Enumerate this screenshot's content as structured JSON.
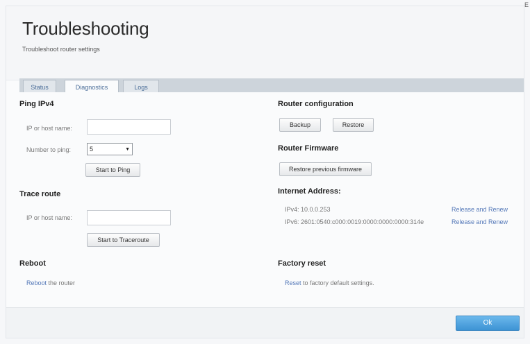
{
  "page": {
    "title": "Troubleshooting",
    "subtitle": "Troubleshoot router settings",
    "corner_mark": "E"
  },
  "tabs": [
    {
      "label": "Status"
    },
    {
      "label": "Diagnostics"
    },
    {
      "label": "Logs"
    }
  ],
  "active_tab": "Diagnostics",
  "ping": {
    "heading": "Ping IPv4",
    "host_label": "IP or host name:",
    "host_value": "",
    "count_label": "Number to ping:",
    "count_value": "5",
    "start_label": "Start to Ping"
  },
  "trace": {
    "heading": "Trace route",
    "host_label": "IP or host name:",
    "host_value": "",
    "start_label": "Start to Traceroute"
  },
  "reboot": {
    "heading": "Reboot",
    "link": "Reboot",
    "rest": " the router"
  },
  "router_config": {
    "heading": "Router configuration",
    "backup_label": "Backup",
    "restore_label": "Restore"
  },
  "firmware": {
    "heading": "Router Firmware",
    "restore_label": "Restore previous firmware"
  },
  "internet": {
    "heading": "Internet Address:",
    "ipv4": "IPv4: 10.0.0.253",
    "ipv6": "IPv6: 2601:0540:c000:0019:0000:0000:0000:314e",
    "release_label_1": "Release and Renew",
    "release_label_2": "Release and Renew"
  },
  "factory": {
    "heading": "Factory reset",
    "link": "Reset",
    "rest": " to factory default settings."
  },
  "footer": {
    "ok_label": "Ok"
  },
  "colors": {
    "link": "#5478b8",
    "ok_button": "#3d93d4"
  }
}
